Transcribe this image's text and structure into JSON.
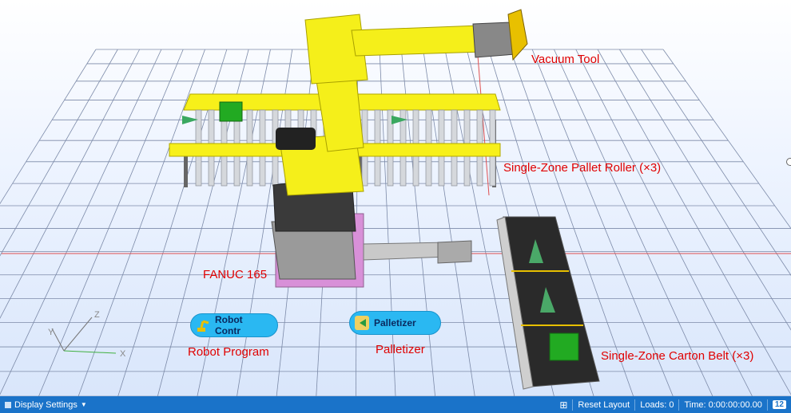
{
  "viewport": {
    "labels": {
      "vacuum_tool": "Vacuum Tool",
      "pallet_roller": "Single-Zone Pallet Roller (×3)",
      "robot": "FANUC 165",
      "carton_belt": "Single-Zone Carton Belt (×3)",
      "robot_program": "Robot Program",
      "palletizer": "Palletizer"
    },
    "nodes": {
      "robot_controller": "Robot Contr",
      "palletizer": "Palletizer"
    },
    "axis": {
      "x": "X",
      "y": "Y",
      "z": "Z"
    },
    "colors": {
      "robot": "#f5ef1a",
      "label": "#e00000",
      "grid": "#7c8aa8",
      "base": "#d890d8"
    }
  },
  "statusbar": {
    "display_settings": "Display Settings",
    "reset_layout": "Reset Layout",
    "loads": "Loads: 0",
    "time": "Time: 0:00:00:00.00",
    "speed_badge": "12"
  }
}
